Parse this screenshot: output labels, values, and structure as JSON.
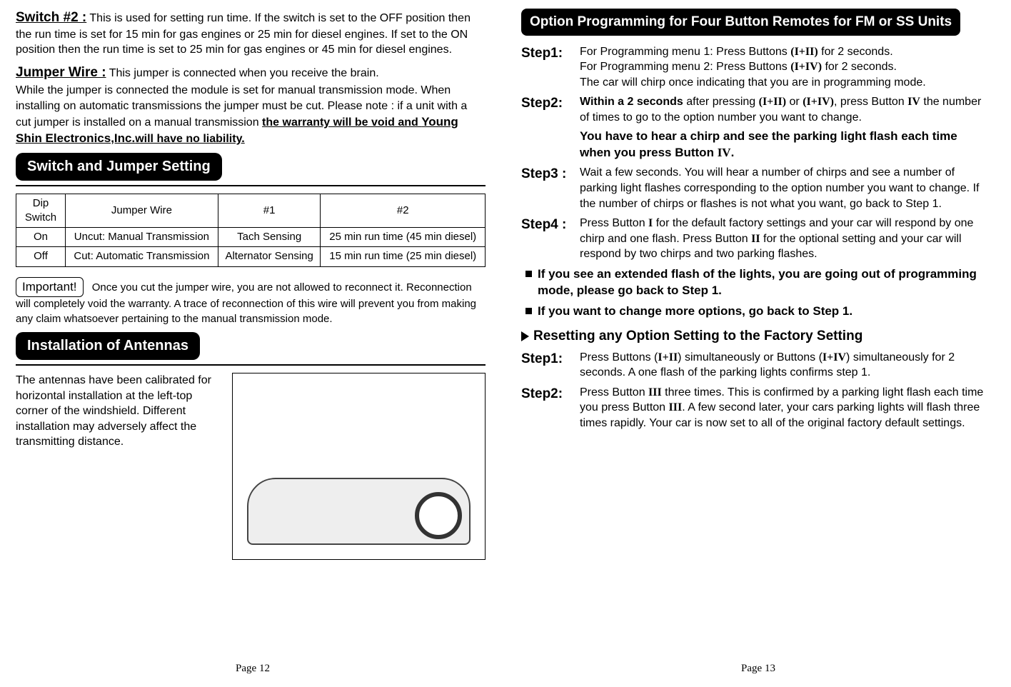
{
  "left": {
    "switch2_label": "Switch #2 :",
    "switch2_text": "This is used for setting run time.  If the switch is set to the OFF position then the run time is set for 15 min for gas engines or 25 min for diesel engines.  If set to the ON position then the run time is set to 25 min for gas engines or 45 min for diesel engines.",
    "jumper_label": "Jumper Wire :",
    "jumper_text1": "This jumper is connected when you receive the brain.",
    "jumper_text2": "While the jumper is connected  the module is set for manual transmission mode.  When installing on automatic transmissions the jumper must be cut.  Please note : if a unit with a cut jumper is installed on a manual transmission ",
    "jumper_warn_a": "the warranty will be void and ",
    "jumper_warn_b": "Young Shin Electronics,Inc.",
    "jumper_warn_c": "will have no liability.",
    "section_switch_header": "Switch and Jumper Setting",
    "table": {
      "h0": "Dip Switch",
      "h1": "Jumper Wire",
      "h2": "#1",
      "h3": "#2",
      "r1c0": "On",
      "r1c1": "Uncut: Manual Transmission",
      "r1c2": "Tach Sensing",
      "r1c3": "25 min run time (45 min diesel)",
      "r2c0": "Off",
      "r2c1": "Cut: Automatic Transmission",
      "r2c2": "Alternator Sensing",
      "r2c3": "15 min run time (25 min diesel)"
    },
    "important_label": "Important!",
    "important_text": "Once you cut the jumper wire, you are not allowed to reconnect it.  Reconnection will completely void the warranty. A trace of reconnection of this wire will prevent you from making any claim whatsoever pertaining to the manual transmission mode.",
    "section_antenna_header": "Installation of Antennas",
    "antenna_text": "The antennas have been calibrated for horizontal installation at the left-top corner of the windshield.  Different installation may adversely affect the transmitting distance.",
    "page_num": "Page 12"
  },
  "right": {
    "header": "Option Programming for Four Button Remotes for FM or SS Units",
    "step1_label": "Step1:",
    "step1_a": "For Programming menu 1: Press Buttons ",
    "step1_combo1": "(I+II)",
    "step1_b": " for 2 seconds.",
    "step1_c": "For Programming menu 2: Press Buttons ",
    "step1_combo2": "(I+IV)",
    "step1_d": " for 2 seconds.",
    "step1_e": "The car will chirp once indicating that you are in programming mode.",
    "step2_label": "Step2:",
    "step2_a": "Within a 2 seconds",
    "step2_b": " after pressing ",
    "step2_c1": "(I+II)",
    "step2_d": " or ",
    "step2_c2": "(I+IV)",
    "step2_e": ", press Button ",
    "step2_btn": "IV",
    "step2_f": " the number of times to go to the option number you want to change.",
    "step2_note_a": "You have to hear a chirp and see the parking light flash each time when you press Button ",
    "step2_note_b": "IV",
    "step2_note_c": ".",
    "step3_label": "Step3 :",
    "step3_text": "Wait a few seconds.  You will hear a number of chirps and see a number of parking light flashes corresponding to the option number you want to change.  If the number of chirps or flashes is not what you want, go back to Step 1.",
    "step4_label": "Step4 :",
    "step4_a": "Press Button ",
    "step4_btnI": "I",
    "step4_b": " for the default factory settings and your car will respond by one chirp and one flash.  Press Button ",
    "step4_btnII": "II",
    "step4_c": " for the optional setting and your car will respond by two chirps and two parking flashes.",
    "bullet1": "If you see an extended flash of the lights, you are going out of programming mode, please go back to Step 1.",
    "bullet2": "If you want to change more options, go back to Step 1.",
    "reset_header": "Resetting any Option Setting to the Factory Setting",
    "rstep1_label": "Step1:",
    "rstep1_a": "Press Buttons (",
    "rstep1_c1": "I+II",
    "rstep1_b": ") simultaneously or Buttons (",
    "rstep1_c2": "I+IV",
    "rstep1_c": ") simultaneously for 2 seconds. A one flash of the parking lights confirms step 1.",
    "rstep2_label": "Step2:",
    "rstep2_a": "Press Button ",
    "rstep2_btn": "III",
    "rstep2_b": " three times. This is confirmed by a parking light flash each time you press Button ",
    "rstep2_btn2": "III",
    "rstep2_c": ". A few second later, your cars parking lights will flash three times rapidly. Your car is now set to all of the original factory default settings.",
    "page_num": "Page 13"
  }
}
